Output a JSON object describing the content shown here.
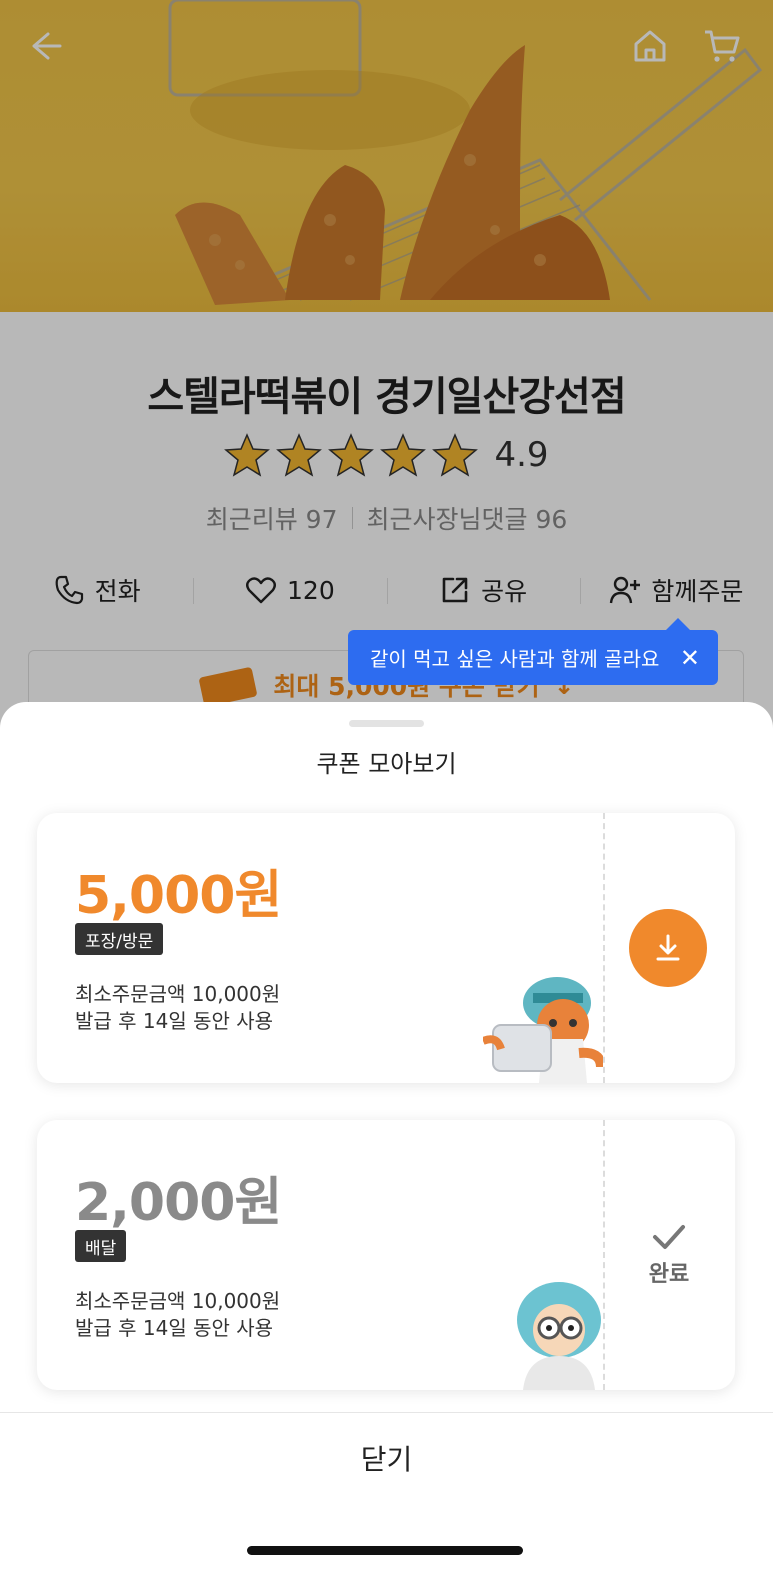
{
  "header": {
    "back_icon": "arrow-left-icon",
    "home_icon": "home-icon",
    "cart_icon": "cart-icon"
  },
  "store": {
    "name": "스텔라떡볶이 경기일산강선점",
    "rating": "4.9",
    "stars": 5,
    "recent_reviews": "최근리뷰 97",
    "owner_replies": "최근사장님댓글 96"
  },
  "actions": {
    "call": "전화",
    "likes": "120",
    "share": "공유",
    "group_order": "함께주문"
  },
  "banner": {
    "text": "최대 5,000원 쿠폰 받기"
  },
  "tooltip": {
    "text": "같이 먹고 싶은 사람과 함께 골라요"
  },
  "sheet": {
    "title": "쿠폰 모아보기",
    "close_label": "닫기"
  },
  "coupons": [
    {
      "amount": "5,000원",
      "tag": "포장/방문",
      "min_order": "최소주문금액 10,000원",
      "validity": "발급 후 14일 동안 사용",
      "status": "download"
    },
    {
      "amount": "2,000원",
      "tag": "배달",
      "min_order": "최소주문금액 10,000원",
      "validity": "발급 후 14일 동안 사용",
      "status": "done",
      "status_label": "완료"
    }
  ],
  "colors": {
    "accent": "#f0892c",
    "tooltip": "#2d6cf0",
    "hero_bg": "#f2c447"
  }
}
